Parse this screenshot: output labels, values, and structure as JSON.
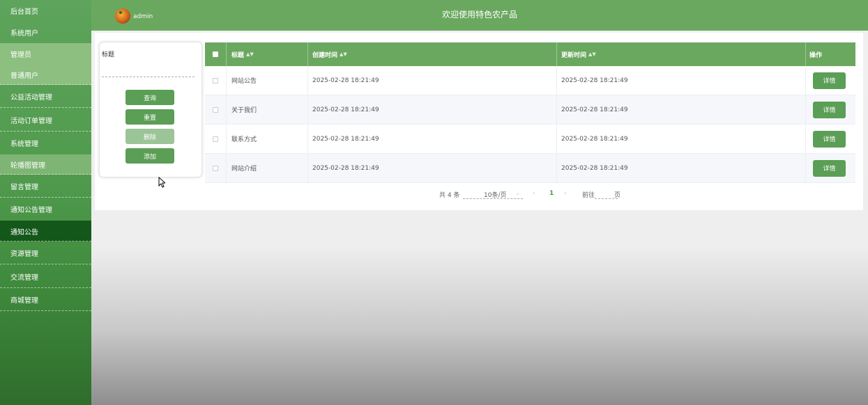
{
  "sidebar": {
    "items": [
      {
        "label": "后台首页"
      },
      {
        "label": "系统用户"
      },
      {
        "label": "管理员"
      },
      {
        "label": "普通用户"
      },
      {
        "label": "公益活动管理"
      },
      {
        "label": "活动订单管理"
      },
      {
        "label": "系统管理"
      },
      {
        "label": "轮播图管理"
      },
      {
        "label": "留言管理"
      },
      {
        "label": "通知公告管理"
      },
      {
        "label": "通知公告"
      },
      {
        "label": "资源管理"
      },
      {
        "label": "交流管理"
      },
      {
        "label": "商城管理"
      }
    ]
  },
  "header": {
    "username": "admin",
    "title": "欢迎使用特色农产品"
  },
  "search": {
    "label": "标题",
    "value": "",
    "query_label": "查询",
    "reset_label": "重置",
    "delete_label": "删除",
    "add_label": "添加"
  },
  "table": {
    "columns": [
      "标题",
      "创建时间",
      "更新时间",
      "操作"
    ],
    "rows": [
      {
        "title": "网站公告",
        "created": "2025-02-28 18:21:49",
        "updated": "2025-02-28 18:21:49",
        "action": "详情"
      },
      {
        "title": "关于我们",
        "created": "2025-02-28 18:21:49",
        "updated": "2025-02-28 18:21:49",
        "action": "详情"
      },
      {
        "title": "联系方式",
        "created": "2025-02-28 18:21:49",
        "updated": "2025-02-28 18:21:49",
        "action": "详情"
      },
      {
        "title": "网站介绍",
        "created": "2025-02-28 18:21:49",
        "updated": "2025-02-28 18:21:49",
        "action": "详情"
      }
    ]
  },
  "pagination": {
    "total": "共 4 条",
    "page_size": "10条/页",
    "current_page": "1",
    "goto_label": "前往",
    "goto_unit": "页"
  },
  "colors": {
    "primary": "#6aa85f",
    "button": "#5b9e55",
    "active_nav": "#14571a"
  }
}
